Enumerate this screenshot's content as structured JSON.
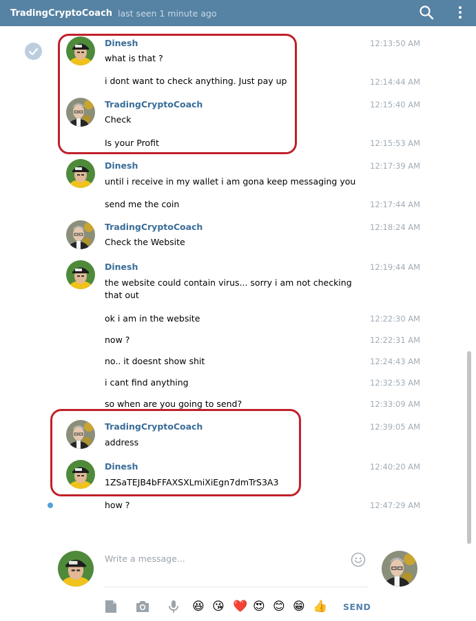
{
  "header": {
    "title": "TradingCryptoCoach",
    "status": "last seen 1 minute ago"
  },
  "messages": [
    {
      "sender": "Dinesh",
      "text": "what is that ?",
      "time": "12:13:50 AM"
    },
    {
      "text": "i dont want to check anything. Just pay up",
      "time": "12:14:44 AM"
    },
    {
      "sender": "TradingCryptoCoach",
      "text": "Check",
      "time": "12:15:40 AM"
    },
    {
      "text": "Is your Profit",
      "time": "12:15:53 AM"
    },
    {
      "sender": "Dinesh",
      "text": "until i receive in my wallet i am gona keep messaging you",
      "time": "12:17:39 AM"
    },
    {
      "text": "send me the coin",
      "time": "12:17:44 AM"
    },
    {
      "sender": "TradingCryptoCoach",
      "text": "Check the Website",
      "time": "12:18:24 AM"
    },
    {
      "sender": "Dinesh",
      "text": "the website could contain virus... sorry i am not checking that out",
      "time": "12:19:44 AM"
    },
    {
      "text": "ok i am in the website",
      "time": "12:22:30 AM"
    },
    {
      "text": "now ?",
      "time": "12:22:31 AM"
    },
    {
      "text": "no.. it doesnt show shit",
      "time": "12:24:43 AM"
    },
    {
      "text": "i cant find anything",
      "time": "12:32:53 AM"
    },
    {
      "text": "so when are you going to send?",
      "time": "12:33:09 AM"
    },
    {
      "sender": "TradingCryptoCoach",
      "text": "address",
      "time": "12:39:05 AM"
    },
    {
      "sender": "Dinesh",
      "text": "1ZSaTEJB4bFFAXSXLmiXiEgn7dmTrS3A3",
      "time": "12:40:20 AM"
    },
    {
      "text": "how ?",
      "time": "12:47:29 AM"
    }
  ],
  "composer": {
    "placeholder": "Write a message...",
    "send_label": "SEND"
  },
  "icons": {
    "emoji_1": "😆",
    "emoji_2": "😘",
    "emoji_3": "❤️",
    "emoji_4": "😍",
    "emoji_5": "😊",
    "emoji_6": "😁",
    "emoji_7": "👍"
  },
  "colors": {
    "header": "#5682a3",
    "sender_name": "#3a6d99",
    "timestamp": "#a0acb6",
    "highlight_box": "#c0202a",
    "send": "#5282ad"
  }
}
